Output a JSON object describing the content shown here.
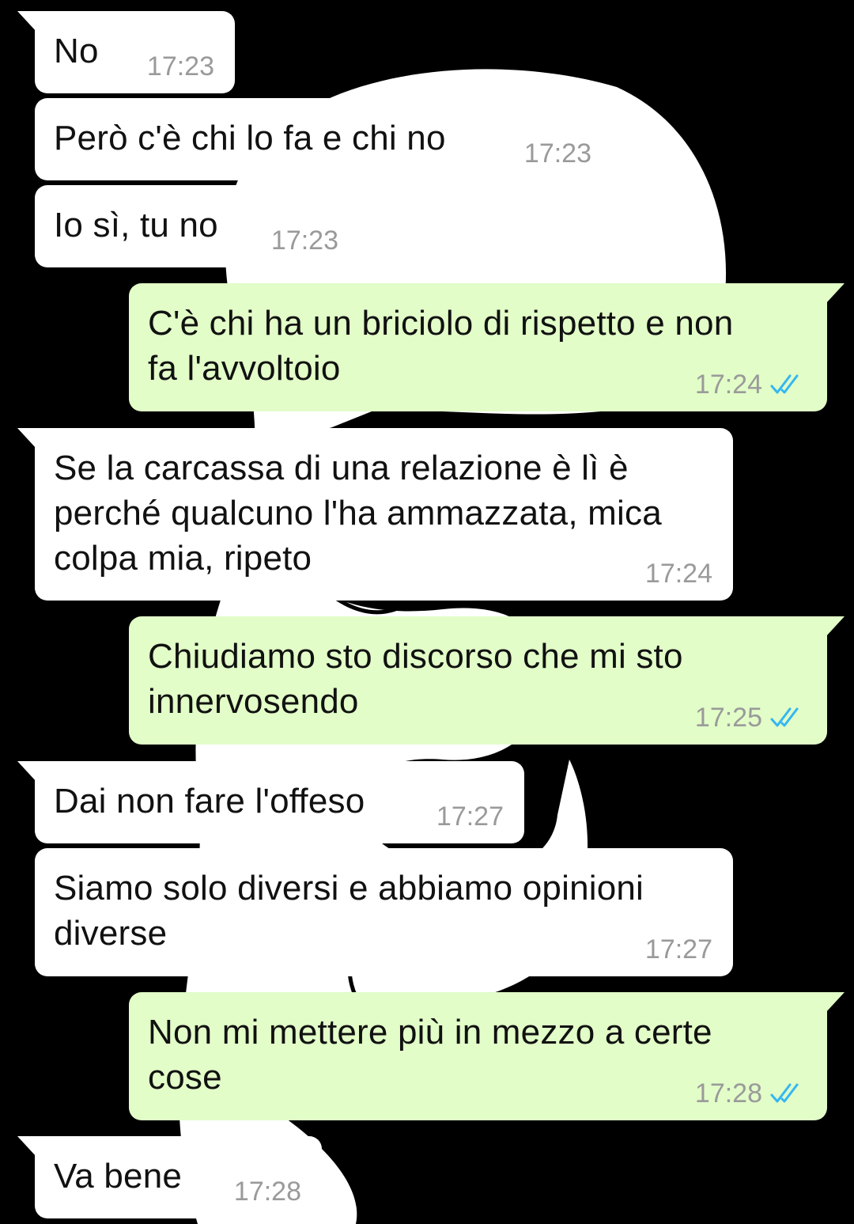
{
  "colors": {
    "incoming_bubble": "#ffffff",
    "outgoing_bubble": "#e2fdc8",
    "read_ticks": "#34b7f1",
    "timestamp": "#9a9a9a",
    "background": "#000000"
  },
  "messages": [
    {
      "direction": "in",
      "text": "No",
      "time": "17:23"
    },
    {
      "direction": "in",
      "text": "Però c'è chi lo fa e chi no",
      "time": "17:23"
    },
    {
      "direction": "in",
      "text": "Io sì, tu no",
      "time": "17:23"
    },
    {
      "direction": "out",
      "text": "C'è chi ha un briciolo di rispetto e non\nfa l'avvoltoio",
      "time": "17:24",
      "status_icon": "double-check-read-icon"
    },
    {
      "direction": "in",
      "text": "Se la carcassa di una relazione è lì è\nperché qualcuno l'ha ammazzata, mica\ncolpa mia, ripeto",
      "time": "17:24"
    },
    {
      "direction": "out",
      "text": "Chiudiamo sto discorso che mi sto\ninnervosendo",
      "time": "17:25",
      "status_icon": "double-check-read-icon"
    },
    {
      "direction": "in",
      "text": "Dai non fare l'offeso",
      "time": "17:27"
    },
    {
      "direction": "in",
      "text": "Siamo solo diversi e abbiamo opinioni\ndiverse",
      "time": "17:27"
    },
    {
      "direction": "out",
      "text": "Non mi mettere più in mezzo a certe\ncose",
      "time": "17:28",
      "status_icon": "double-check-read-icon"
    },
    {
      "direction": "in",
      "text": "Va bene",
      "time": "17:28"
    }
  ]
}
